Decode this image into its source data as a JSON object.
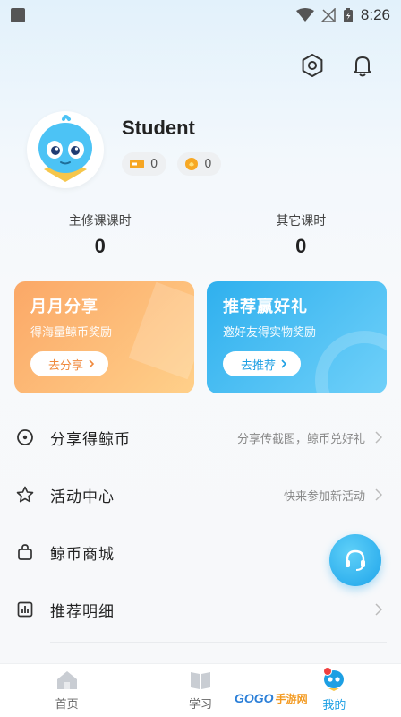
{
  "status_bar": {
    "time": "8:26"
  },
  "profile": {
    "username": "Student",
    "tickets": "0",
    "coins": "0"
  },
  "hours": {
    "main_label": "主修课课时",
    "main_value": "0",
    "other_label": "其它课时",
    "other_value": "0"
  },
  "cards": {
    "share": {
      "title": "月月分享",
      "subtitle": "得海量鲸币奖励",
      "button": "去分享"
    },
    "recommend": {
      "title": "推荐赢好礼",
      "subtitle": "邀好友得实物奖励",
      "button": "去推荐"
    }
  },
  "menu": {
    "items": [
      {
        "label": "分享得鲸币",
        "hint": "分享传截图，鲸币兑好礼",
        "icon": "target-icon"
      },
      {
        "label": "活动中心",
        "hint": "快来参加新活动",
        "icon": "star-icon"
      },
      {
        "label": "鲸币商城",
        "hint": "",
        "icon": "shopping-bag-icon"
      },
      {
        "label": "推荐明细",
        "hint": "",
        "icon": "bar-chart-icon"
      }
    ]
  },
  "tabs": [
    {
      "label": "首页",
      "icon": "home-icon"
    },
    {
      "label": "学习",
      "icon": "book-icon"
    },
    {
      "label": "我的",
      "icon": "mascot-icon",
      "active": true
    }
  ],
  "watermark": {
    "logo": "GOGO",
    "text": "手游网"
  },
  "colors": {
    "accent": "#1d9fe3",
    "orange": "#fba867",
    "badge_red": "#f04040"
  }
}
